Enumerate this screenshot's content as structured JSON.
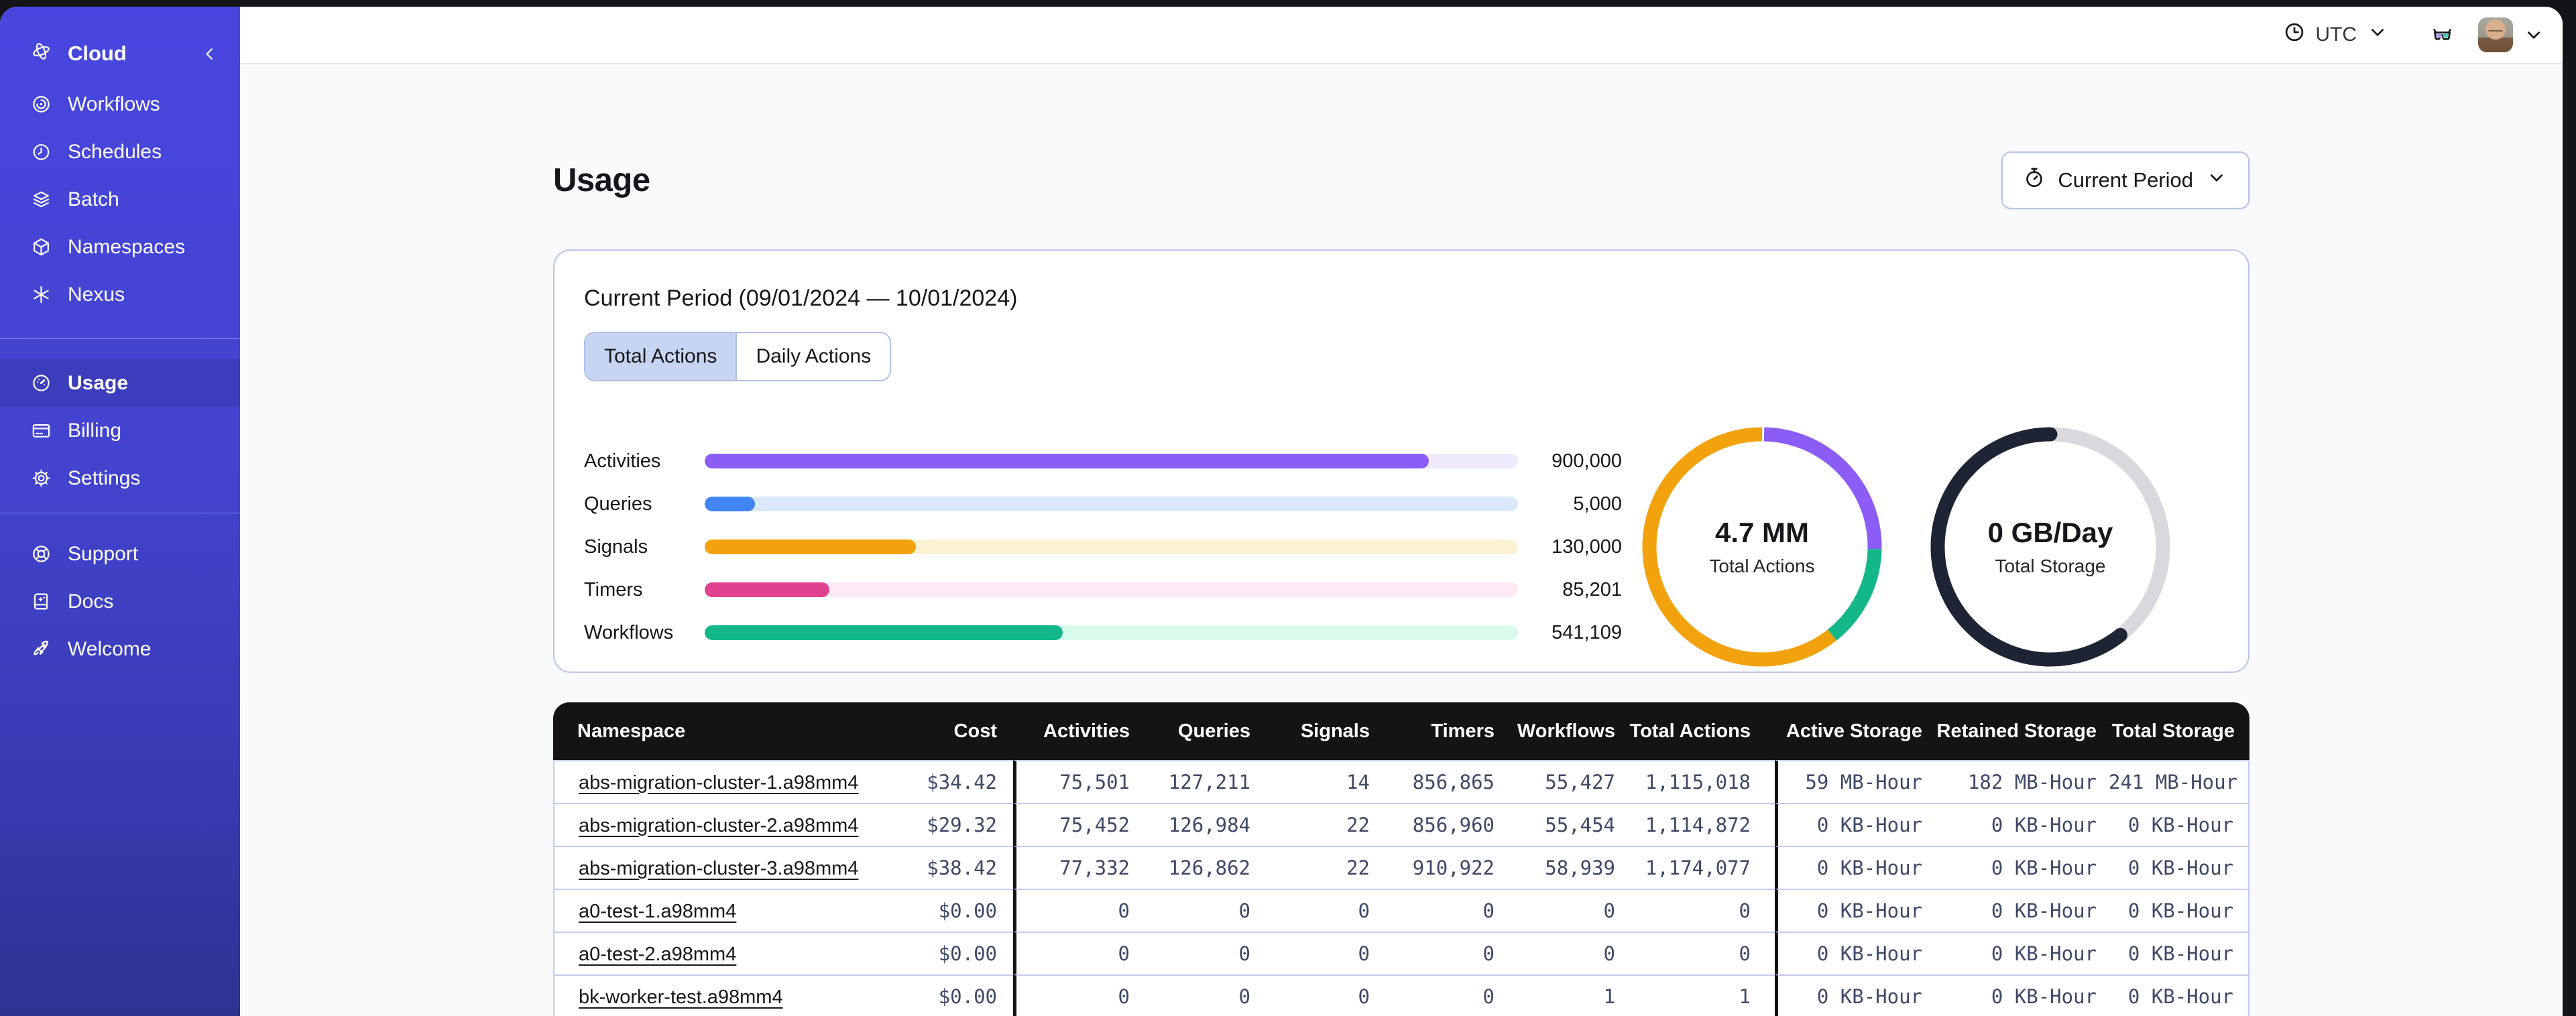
{
  "sidebar": {
    "brand": {
      "label": "Cloud",
      "icon": "temporal-logo-icon"
    },
    "primary": [
      {
        "label": "Workflows",
        "icon": "workflows-icon",
        "active": false
      },
      {
        "label": "Schedules",
        "icon": "schedules-icon",
        "active": false
      },
      {
        "label": "Batch",
        "icon": "batch-icon",
        "active": false
      },
      {
        "label": "Namespaces",
        "icon": "namespaces-icon",
        "active": false
      },
      {
        "label": "Nexus",
        "icon": "nexus-icon",
        "active": false
      }
    ],
    "account": [
      {
        "label": "Usage",
        "icon": "usage-icon",
        "active": true
      },
      {
        "label": "Billing",
        "icon": "billing-icon",
        "active": false
      },
      {
        "label": "Settings",
        "icon": "settings-icon",
        "active": false
      }
    ],
    "footer": [
      {
        "label": "Support",
        "icon": "support-icon",
        "active": false
      },
      {
        "label": "Docs",
        "icon": "docs-icon",
        "active": false
      },
      {
        "label": "Welcome",
        "icon": "welcome-icon",
        "active": false
      }
    ]
  },
  "header": {
    "timezone": "UTC",
    "icons": [
      "clock-icon",
      "chevron-down-icon",
      "glasses-icon",
      "avatar",
      "chevron-down-icon"
    ]
  },
  "page": {
    "title": "Usage",
    "period_button_label": "Current Period"
  },
  "card": {
    "title": "Current Period (09/01/2024 — 10/01/2024)",
    "tabs": [
      {
        "label": "Total Actions",
        "active": true
      },
      {
        "label": "Daily Actions",
        "active": false
      }
    ]
  },
  "chart_data": [
    {
      "type": "bar",
      "orientation": "horizontal",
      "categories": [
        "Activities",
        "Queries",
        "Signals",
        "Timers",
        "Workflows"
      ],
      "values": [
        900000,
        5000,
        130000,
        85201,
        541109
      ],
      "value_labels": [
        "900,000",
        "5,000",
        "130,000",
        "85,201",
        "541,109"
      ],
      "fill_fractions": [
        0.89,
        0.062,
        0.26,
        0.153,
        0.44
      ],
      "fill_colors": [
        "#8B5CF6",
        "#4285F6",
        "#F2A20D",
        "#E0428F",
        "#14B789"
      ],
      "track_colors": [
        "#EFEBFC",
        "#DCE8FC",
        "#FBF2D2",
        "#FDE9F6",
        "#D9FBEB"
      ],
      "title": "",
      "xlabel": "",
      "ylabel": "",
      "grid": false,
      "legend": "none"
    },
    {
      "type": "pie",
      "style": "donut",
      "center_label": "4.7 MM",
      "center_sublabel": "Total Actions",
      "segments": [
        {
          "name": "purple",
          "color": "#8B5CF6",
          "fraction": 0.25
        },
        {
          "name": "green",
          "color": "#14B789",
          "fraction": 0.14
        },
        {
          "name": "orange",
          "color": "#F2A20D",
          "fraction": 0.61
        }
      ],
      "start_angle_deg": 0,
      "direction": "clockwise",
      "legend": "none"
    },
    {
      "type": "pie",
      "style": "donut",
      "center_label": "0 GB/Day",
      "center_sublabel": "Total Storage",
      "segments": [
        {
          "name": "gray",
          "color": "#D8D8DD",
          "fraction": 0.39
        },
        {
          "name": "dark",
          "color": "#1D2433",
          "fraction": 0.61,
          "rounded_caps": true
        }
      ],
      "start_angle_deg": 0,
      "direction": "clockwise",
      "legend": "none"
    }
  ],
  "table": {
    "columns": [
      "Namespace",
      "Cost",
      "Activities",
      "Queries",
      "Signals",
      "Timers",
      "Workflows",
      "Total Actions",
      "Active Storage",
      "Retained Storage",
      "Total Storage"
    ],
    "rows": [
      {
        "namespace": "abs-migration-cluster-1.a98mm4",
        "cost": "$34.42",
        "activities": "75,501",
        "queries": "127,211",
        "signals": "14",
        "timers": "856,865",
        "workflows": "55,427",
        "total_actions": "1,115,018",
        "active_storage": "59 MB-Hour",
        "retained_storage": "182 MB-Hour",
        "total_storage": "241 MB-Hour"
      },
      {
        "namespace": "abs-migration-cluster-2.a98mm4",
        "cost": "$29.32",
        "activities": "75,452",
        "queries": "126,984",
        "signals": "22",
        "timers": "856,960",
        "workflows": "55,454",
        "total_actions": "1,114,872",
        "active_storage": "0 KB-Hour",
        "retained_storage": "0 KB-Hour",
        "total_storage": "0 KB-Hour"
      },
      {
        "namespace": "abs-migration-cluster-3.a98mm4",
        "cost": "$38.42",
        "activities": "77,332",
        "queries": "126,862",
        "signals": "22",
        "timers": "910,922",
        "workflows": "58,939",
        "total_actions": "1,174,077",
        "active_storage": "0 KB-Hour",
        "retained_storage": "0 KB-Hour",
        "total_storage": "0 KB-Hour"
      },
      {
        "namespace": "a0-test-1.a98mm4",
        "cost": "$0.00",
        "activities": "0",
        "queries": "0",
        "signals": "0",
        "timers": "0",
        "workflows": "0",
        "total_actions": "0",
        "active_storage": "0 KB-Hour",
        "retained_storage": "0 KB-Hour",
        "total_storage": "0 KB-Hour"
      },
      {
        "namespace": "a0-test-2.a98mm4",
        "cost": "$0.00",
        "activities": "0",
        "queries": "0",
        "signals": "0",
        "timers": "0",
        "workflows": "0",
        "total_actions": "0",
        "active_storage": "0 KB-Hour",
        "retained_storage": "0 KB-Hour",
        "total_storage": "0 KB-Hour"
      },
      {
        "namespace": "bk-worker-test.a98mm4",
        "cost": "$0.00",
        "activities": "0",
        "queries": "0",
        "signals": "0",
        "timers": "0",
        "workflows": "1",
        "total_actions": "1",
        "active_storage": "0 KB-Hour",
        "retained_storage": "0 KB-Hour",
        "total_storage": "0 KB-Hour"
      }
    ]
  }
}
